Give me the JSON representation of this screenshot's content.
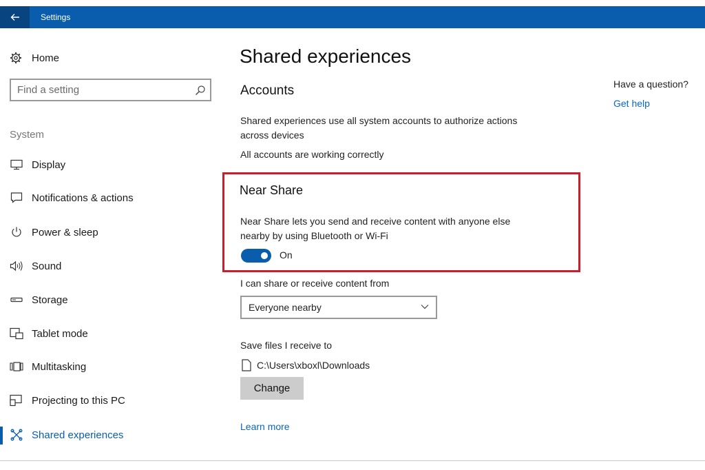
{
  "window": {
    "title": "Settings"
  },
  "sidebar": {
    "home_label": "Home",
    "search_placeholder": "Find a setting",
    "section_label": "System",
    "items": [
      {
        "label": "Display",
        "icon": "monitor-icon"
      },
      {
        "label": "Notifications & actions",
        "icon": "notification-icon"
      },
      {
        "label": "Power & sleep",
        "icon": "power-icon"
      },
      {
        "label": "Sound",
        "icon": "speaker-icon"
      },
      {
        "label": "Storage",
        "icon": "storage-icon"
      },
      {
        "label": "Tablet mode",
        "icon": "tablet-mode-icon"
      },
      {
        "label": "Multitasking",
        "icon": "multitasking-icon"
      },
      {
        "label": "Projecting to this PC",
        "icon": "projecting-icon"
      },
      {
        "label": "Shared experiences",
        "icon": "shared-experiences-icon",
        "selected": true
      }
    ]
  },
  "main": {
    "title": "Shared experiences",
    "accounts": {
      "heading": "Accounts",
      "description_line1": "Shared experiences use all system accounts to authorize actions",
      "description_line2": "across devices",
      "status": "All accounts are working correctly"
    },
    "near_share": {
      "heading": "Near Share",
      "description_line1": "Near Share lets you send and receive content with anyone else",
      "description_line2": "nearby by using Bluetooth or Wi-Fi",
      "toggle_state": "On",
      "toggle_on": true
    },
    "share_from": {
      "label": "I can share or receive content from",
      "selected": "Everyone nearby"
    },
    "save_files": {
      "label": "Save files I receive to",
      "path": "C:\\Users\\xboxl\\Downloads",
      "change_button": "Change"
    },
    "learn_more": "Learn more"
  },
  "help": {
    "question": "Have a question?",
    "link": "Get help"
  },
  "colors": {
    "accent": "#0a5dad",
    "highlight_border": "#c7202d",
    "link": "#0a66c2"
  }
}
